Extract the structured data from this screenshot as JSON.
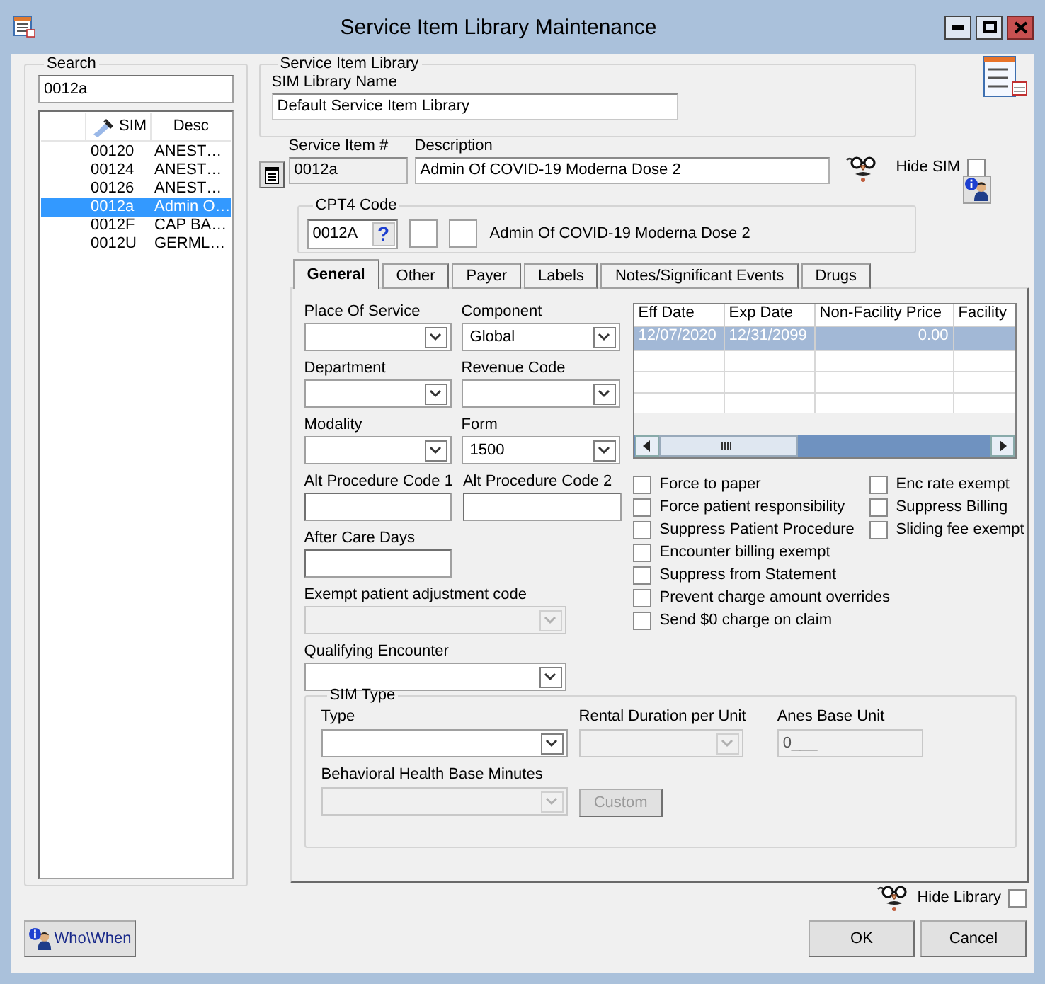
{
  "window": {
    "title": "Service Item Library Maintenance"
  },
  "search": {
    "label": "Search",
    "value": "0012a",
    "columns": [
      "SIM",
      "Desc"
    ],
    "rows": [
      {
        "sim": "00120",
        "desc": "ANEST…",
        "selected": false
      },
      {
        "sim": "00124",
        "desc": "ANEST…",
        "selected": false
      },
      {
        "sim": "00126",
        "desc": "ANEST…",
        "selected": false
      },
      {
        "sim": "0012a",
        "desc": "Admin O…",
        "selected": true
      },
      {
        "sim": "0012F",
        "desc": "CAP BA…",
        "selected": false
      },
      {
        "sim": "0012U",
        "desc": "GERML…",
        "selected": false
      }
    ]
  },
  "library": {
    "group_label": "Service Item Library",
    "name_label": "SIM Library Name",
    "name_value": "Default Service Item Library"
  },
  "service_item": {
    "number_label": "Service Item #",
    "number_value": "0012a",
    "description_label": "Description",
    "description_value": "Admin Of COVID-19 Moderna Dose 2",
    "hide_sim": {
      "label": "Hide SIM",
      "checked": false
    }
  },
  "cpt4": {
    "label": "CPT4 Code",
    "value": "0012A",
    "help": "?",
    "description": "Admin Of COVID-19 Moderna Dose 2"
  },
  "tabs": [
    {
      "label": "General",
      "selected": true
    },
    {
      "label": "Other",
      "selected": false
    },
    {
      "label": "Payer",
      "selected": false
    },
    {
      "label": "Labels",
      "selected": false
    },
    {
      "label": "Notes/Significant Events",
      "selected": false
    },
    {
      "label": "Drugs",
      "selected": false
    }
  ],
  "field_rows": [
    [
      {
        "kind": "select",
        "label": "Place Of Service",
        "disabled": false
      },
      {
        "kind": "select",
        "label": "Component",
        "value": "Global",
        "disabled": false
      }
    ],
    [
      {
        "kind": "select",
        "label": "Department",
        "disabled": false
      },
      {
        "kind": "select",
        "label": "Revenue Code",
        "disabled": false
      }
    ],
    [
      {
        "kind": "select",
        "label": "Modality",
        "disabled": false
      },
      {
        "kind": "select",
        "label": "Form",
        "value": "1500",
        "disabled": false
      }
    ],
    [
      {
        "kind": "text",
        "label": "Alt Procedure Code 1",
        "disabled": false
      },
      {
        "kind": "text",
        "label": "Alt Procedure Code 2",
        "disabled": false
      }
    ],
    [
      {
        "kind": "text",
        "label": "After Care Days",
        "disabled": false
      }
    ],
    [
      {
        "kind": "select",
        "label": "Exempt patient adjustment code",
        "disabled": true
      }
    ],
    [
      {
        "kind": "select",
        "label": "Qualifying Encounter",
        "disabled": false
      }
    ]
  ],
  "price_table": {
    "columns": [
      "Eff Date",
      "Exp Date",
      "Non-Facility Price",
      "Facility"
    ],
    "rows": [
      {
        "cells": [
          "12/07/2020",
          "12/31/2099",
          "0.00"
        ],
        "selected": true
      }
    ]
  },
  "options_left": [
    {
      "label": "Force to paper",
      "checked": false
    },
    {
      "label": "Force patient responsibility",
      "checked": false
    },
    {
      "label": "Suppress Patient Procedure",
      "checked": false
    },
    {
      "label": "Encounter billing exempt",
      "checked": false
    },
    {
      "label": "Suppress from Statement",
      "checked": false
    },
    {
      "label": "Prevent charge amount overrides",
      "checked": false
    },
    {
      "label": "Send $0 charge on claim",
      "checked": false
    }
  ],
  "options_right": [
    {
      "label": "Enc rate exempt",
      "checked": false
    },
    {
      "label": "Suppress Billing",
      "checked": false
    },
    {
      "label": "Sliding fee exempt",
      "checked": false
    }
  ],
  "sim_type": {
    "label": "SIM Type",
    "type": {
      "kind": "select",
      "label": "Type",
      "disabled": false
    },
    "rental": {
      "kind": "select",
      "label": "Rental Duration per Unit",
      "disabled": true
    },
    "anes": {
      "kind": "text",
      "label": "Anes Base Unit",
      "value": "0___",
      "disabled": true
    },
    "behavioral": {
      "kind": "select",
      "label": "Behavioral Health Base Minutes",
      "disabled": true
    },
    "custom_button": {
      "label": "Custom",
      "disabled": true
    }
  },
  "hide_library": {
    "label": "Hide Library",
    "checked": false
  },
  "buttons": {
    "who_when": "Who\\When",
    "ok": "OK",
    "cancel": "Cancel"
  }
}
